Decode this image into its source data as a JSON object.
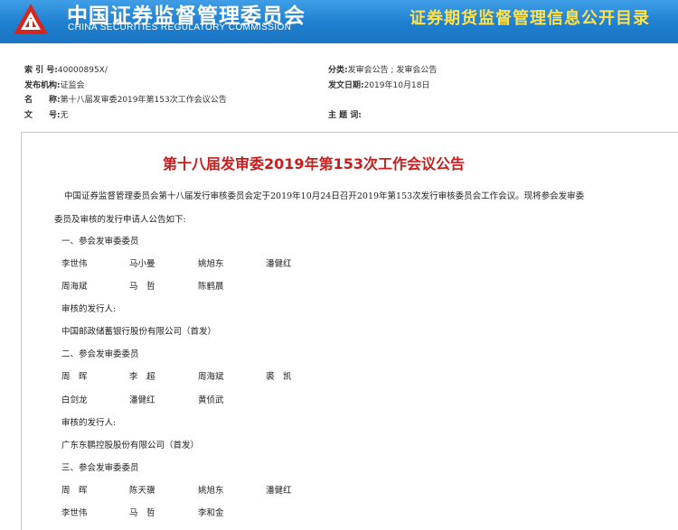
{
  "header": {
    "org_cn": "中国证券监督管理委员会",
    "org_en": "CHINA SECURITIES REGULATORY COMMISSION",
    "site_title": "证券期货监督管理信息公开目录",
    "accent_color": "#1f7fd0",
    "title_color": "#ffe14a"
  },
  "meta": {
    "index_label": "索 引 号:",
    "index_value": "40000895X/",
    "category_label": "分类:",
    "category_value": "发审会公告 ; 发审会公告",
    "publisher_label": "发布机构:",
    "publisher_value": "证监会",
    "date_label": "发文日期:",
    "date_value": "2019年10月18日",
    "name_label": "名　　称:",
    "name_value": "第十八届发审委2019年第153次工作会议公告",
    "docno_label": "文　　号:",
    "docno_value": "无",
    "subject_label": "主 题 词:",
    "subject_value": ""
  },
  "document": {
    "title": "第十八届发审委2019年第153次工作会议公告",
    "title_color": "#cc1c1c",
    "intro_line1": "中国证券监督管理委员会第十八届发行审核委员会定于2019年10月24日召开2019年第153次发行审核委员会工作会议。现将参会发审委",
    "intro_line2": "委员及审核的发行申请人公告如下:",
    "sections": [
      {
        "heading": "一、参会发审委委员",
        "members_row1": [
          "李世伟",
          "马小曼",
          "姚旭东",
          "潘健红"
        ],
        "members_row2": [
          "周海斌",
          "马　哲",
          "陈鹤晨"
        ],
        "issuer_label": "审核的发行人:",
        "issuer": "中国邮政储蓄银行股份有限公司（首发）"
      },
      {
        "heading": "二、参会发审委委员",
        "members_row1": [
          "周　晖",
          "李　超",
          "周海斌",
          "裘　凯"
        ],
        "members_row2": [
          "白剑龙",
          "潘健红",
          "黄侦武"
        ],
        "issuer_label": "审核的发行人:",
        "issuer": "广东东鹏控股股份有限公司（首发）"
      },
      {
        "heading": "三、参会发审委委员",
        "members_row1": [
          "周　晖",
          "陈天骥",
          "姚旭东",
          "潘健红"
        ],
        "members_row2": [
          "李世伟",
          "马　哲",
          "李和金"
        ]
      }
    ]
  }
}
